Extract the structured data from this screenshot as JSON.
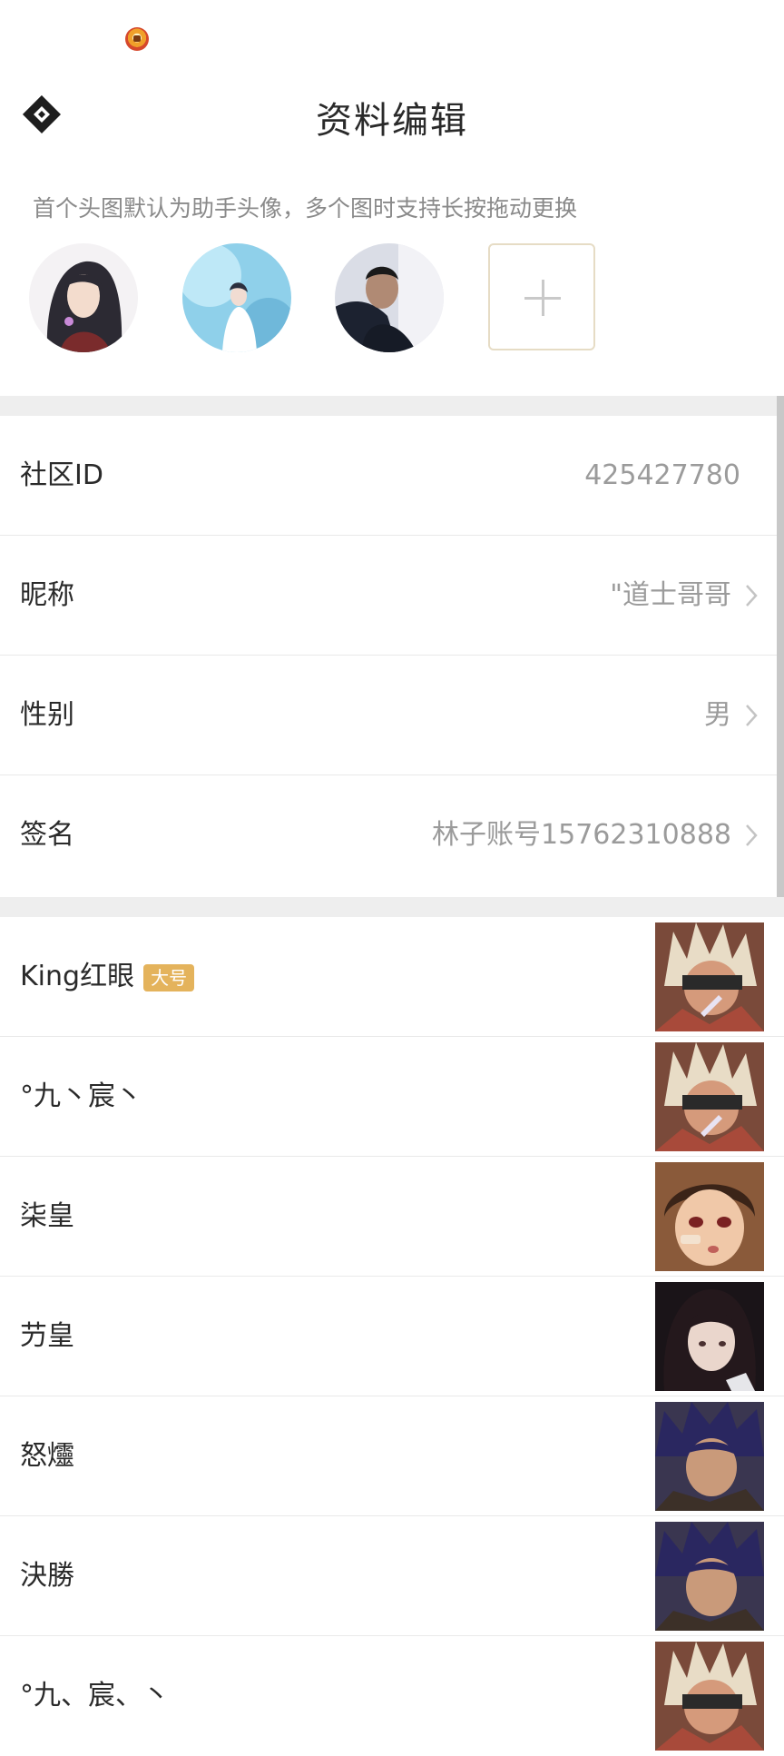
{
  "header": {
    "title": "资料编辑"
  },
  "avatars": {
    "hint": "首个头图默认为助手头像，多个图时支持长按拖动更换",
    "items": [
      "avatar-girl-icon",
      "avatar-white-dress-icon",
      "avatar-man-icon"
    ],
    "add_icon": "plus-icon"
  },
  "profile": {
    "community_id": {
      "label": "社区ID",
      "value": "425427780"
    },
    "nickname": {
      "label": "昵称",
      "value": "\"道士哥哥"
    },
    "gender": {
      "label": "性别",
      "value": "男"
    },
    "signature": {
      "label": "签名",
      "value": "林子账号15762310888"
    }
  },
  "roles": [
    {
      "name": "King红眼",
      "badge": "大号",
      "portrait": "slayer-icon"
    },
    {
      "name": "°九丶宸丶",
      "portrait": "slayer-icon"
    },
    {
      "name": "柒皇",
      "portrait": "fighter-girl-icon"
    },
    {
      "name": "芀皇",
      "portrait": "dark-hair-girl-icon"
    },
    {
      "name": "怒爧",
      "portrait": "dark-knight-icon"
    },
    {
      "name": "決勝",
      "portrait": "dark-knight-icon"
    },
    {
      "name": "°九、宸、丶",
      "portrait": "slayer-icon"
    }
  ],
  "colors": {
    "accent": "#e4b35c",
    "divider": "#eeeeee",
    "value_text": "#9b9b9b"
  }
}
